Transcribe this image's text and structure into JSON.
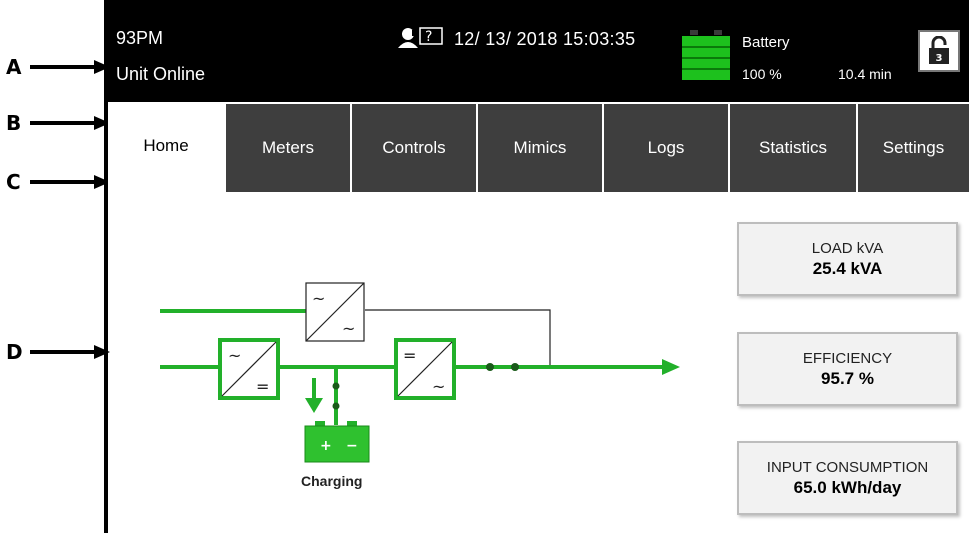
{
  "annotations": [
    "A",
    "B",
    "C",
    "D"
  ],
  "status": {
    "model": "93PM",
    "state": "Unit Online",
    "datetime": "12/ 13/ 2018 15:03:35",
    "battery_label": "Battery",
    "battery_percent": "100 %",
    "battery_time": "10.4 min",
    "lock_level": "3",
    "battery_level": 1.0
  },
  "tabs": [
    {
      "label": "Home",
      "active": true
    },
    {
      "label": "Meters"
    },
    {
      "label": "Controls"
    },
    {
      "label": "Mimics"
    },
    {
      "label": "Logs"
    },
    {
      "label": "Statistics"
    },
    {
      "label": "Settings"
    }
  ],
  "mimic": {
    "battery_state": "Charging",
    "rectifier_top": "~",
    "rectifier_bottom": "=",
    "inverter_top": "=",
    "inverter_bottom": "~",
    "bypass_top": "~",
    "bypass_bottom": "~",
    "battery_plus": "+",
    "battery_minus": "−"
  },
  "cards": [
    {
      "label": "LOAD kVA",
      "value": "25.4 kVA"
    },
    {
      "label": "EFFICIENCY",
      "value": "95.7 %"
    },
    {
      "label": "INPUT CONSUMPTION",
      "value": "65.0 kWh/day"
    }
  ],
  "colors": {
    "flow_green": "#22b02a",
    "statusbar": "#000000",
    "tab_dark": "#3e3e3e"
  }
}
